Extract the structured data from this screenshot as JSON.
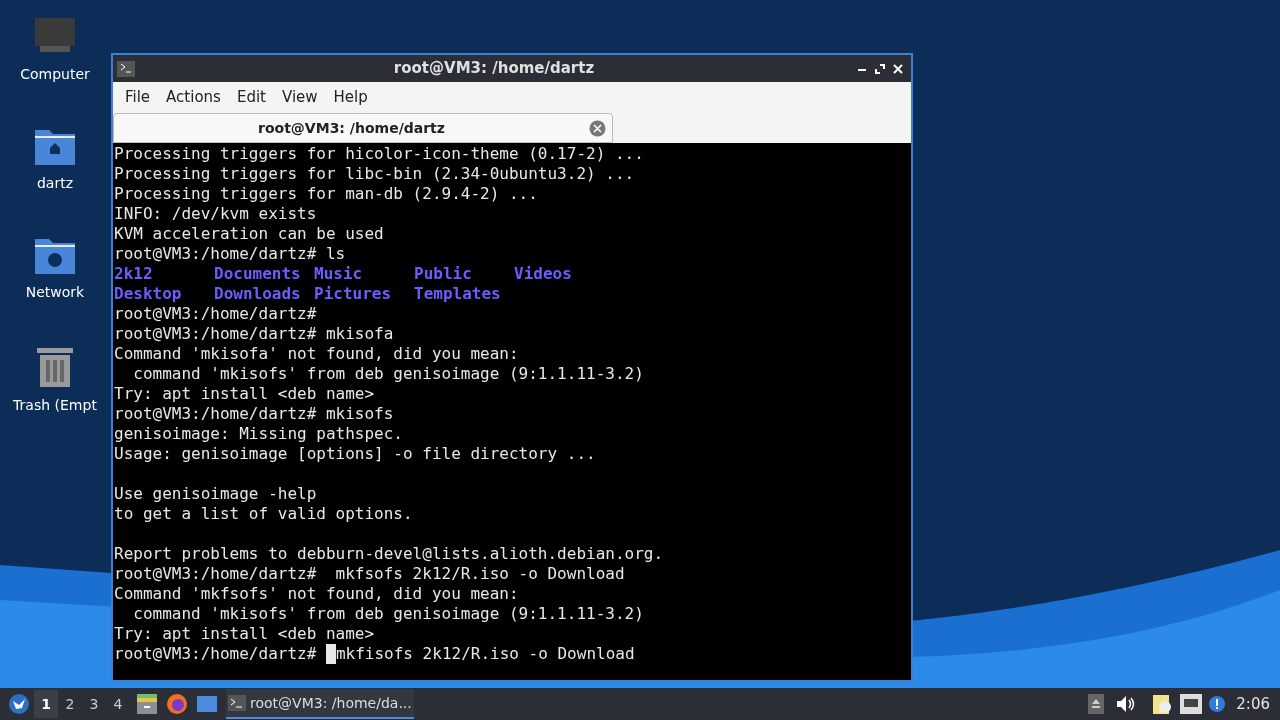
{
  "desktop_icons": [
    {
      "kind": "computer",
      "label": "Computer"
    },
    {
      "kind": "home",
      "label": "dartz"
    },
    {
      "kind": "network",
      "label": "Network"
    },
    {
      "kind": "trash",
      "label": "Trash (Empt"
    }
  ],
  "window": {
    "title": "root@VM3: /home/dartz",
    "menu": [
      "File",
      "Actions",
      "Edit",
      "View",
      "Help"
    ],
    "tabs": [
      {
        "label": "root@VM3: /home/dartz",
        "selected": true
      }
    ],
    "terminal_lines": [
      {
        "kind": "text",
        "text": "Processing triggers for hicolor-icon-theme (0.17-2) ..."
      },
      {
        "kind": "text",
        "text": "Processing triggers for libc-bin (2.34-0ubuntu3.2) ..."
      },
      {
        "kind": "text",
        "text": "Processing triggers for man-db (2.9.4-2) ..."
      },
      {
        "kind": "text",
        "text": "INFO: /dev/kvm exists"
      },
      {
        "kind": "text",
        "text": "KVM acceleration can be used"
      },
      {
        "kind": "text",
        "text": "root@VM3:/home/dartz# ls"
      },
      {
        "kind": "listing",
        "items": [
          "2k12",
          "Documents",
          "Music",
          "Public",
          "Videos"
        ]
      },
      {
        "kind": "listing",
        "items": [
          "Desktop",
          "Downloads",
          "Pictures",
          "Templates"
        ]
      },
      {
        "kind": "text",
        "text": "root@VM3:/home/dartz#"
      },
      {
        "kind": "text",
        "text": "root@VM3:/home/dartz# mkisofa"
      },
      {
        "kind": "text",
        "text": "Command 'mkisofa' not found, did you mean:"
      },
      {
        "kind": "text",
        "text": "  command 'mkisofs' from deb genisoimage (9:1.1.11-3.2)"
      },
      {
        "kind": "text",
        "text": "Try: apt install <deb name>"
      },
      {
        "kind": "text",
        "text": "root@VM3:/home/dartz# mkisofs"
      },
      {
        "kind": "text",
        "text": "genisoimage: Missing pathspec."
      },
      {
        "kind": "text",
        "text": "Usage: genisoimage [options] -o file directory ..."
      },
      {
        "kind": "blank"
      },
      {
        "kind": "text",
        "text": "Use genisoimage -help"
      },
      {
        "kind": "text",
        "text": "to get a list of valid options."
      },
      {
        "kind": "blank"
      },
      {
        "kind": "text",
        "text": "Report problems to debburn-devel@lists.alioth.debian.org."
      },
      {
        "kind": "text",
        "text": "root@VM3:/home/dartz#  mkfsofs 2k12/R.iso -o Download"
      },
      {
        "kind": "text",
        "text": "Command 'mkfsofs' not found, did you mean:"
      },
      {
        "kind": "text",
        "text": "  command 'mkisofs' from deb genisoimage (9:1.1.11-3.2)"
      },
      {
        "kind": "text",
        "text": "Try: apt install <deb name>"
      },
      {
        "kind": "cursor",
        "before": "root@VM3:/home/dartz# ",
        "after": "mkfisofs 2k12/R.iso -o Download"
      }
    ]
  },
  "taskbar": {
    "workspaces": [
      {
        "label": "1",
        "selected": true
      },
      {
        "label": "2",
        "selected": false
      },
      {
        "label": "3",
        "selected": false
      },
      {
        "label": "4",
        "selected": false
      }
    ],
    "tasks": [
      {
        "label": "root@VM3: /home/da...",
        "selected": true
      }
    ],
    "clock": "2:06"
  }
}
